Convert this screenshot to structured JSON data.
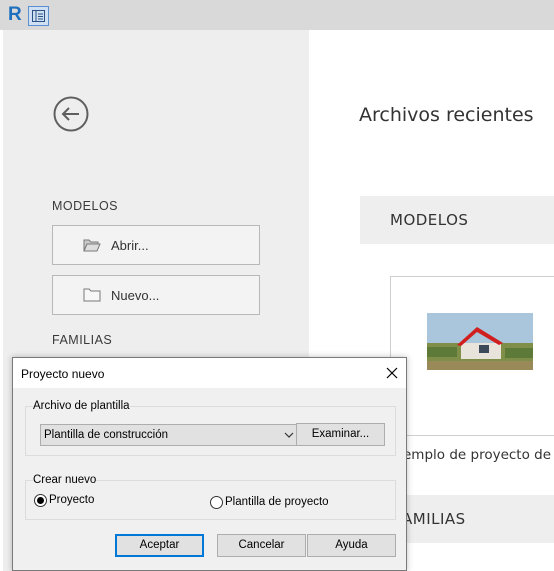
{
  "app": {
    "logo_letter": "R",
    "brand_color": "#1f6fbf"
  },
  "sidebar": {
    "back_icon": "back-arrow-icon",
    "models_label": "MODELOS",
    "open_label": "Abrir...",
    "new_label": "Nuevo...",
    "families_label": "FAMILIAS"
  },
  "main": {
    "title": "Archivos recientes",
    "models_header": "MODELOS",
    "card_caption": "emplo de proyecto de a",
    "families_header": "AMILIAS"
  },
  "dialog": {
    "title": "Proyecto nuevo",
    "template_group_label": "Archivo de plantilla",
    "template_selected": "Plantilla de construcción",
    "browse_label": "Examinar...",
    "create_group_label": "Crear nuevo",
    "option_project": "Proyecto",
    "option_template": "Plantilla de proyecto",
    "selected_option": "Proyecto",
    "ok_label": "Aceptar",
    "cancel_label": "Cancelar",
    "help_label": "Ayuda",
    "accent_color": "#0078d7"
  }
}
